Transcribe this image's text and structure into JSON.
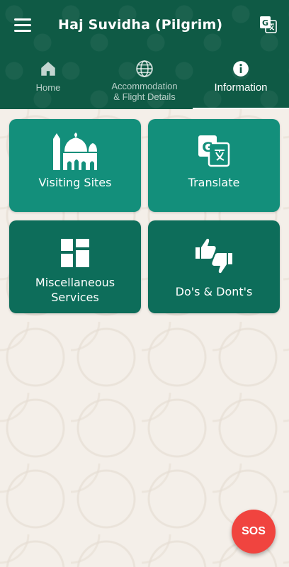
{
  "app_title": "Haj Suvidha (Pilgrim)",
  "tabs": [
    {
      "label": "Home",
      "icon": "home-icon"
    },
    {
      "label_line1": "Accommodation",
      "label_line2": "& Flight Details",
      "icon": "globe-icon"
    },
    {
      "label": "Information",
      "icon": "info-icon",
      "active": true
    }
  ],
  "tiles": [
    {
      "label": "Visiting Sites",
      "icon": "mosque-icon"
    },
    {
      "label": "Translate",
      "icon": "translate-icon"
    },
    {
      "label_line1": "Miscellaneous",
      "label_line2": "Services",
      "icon": "grid-icon"
    },
    {
      "label": "Do's & Dont's",
      "icon": "thumbs-up-down-icon"
    }
  ],
  "sos_label": "SOS",
  "colors": {
    "header": "#0f5a45",
    "tile_light": "#138f7b",
    "tile_dark": "#0d6d5a",
    "sos": "#f0443f",
    "background": "#f4efe9"
  }
}
